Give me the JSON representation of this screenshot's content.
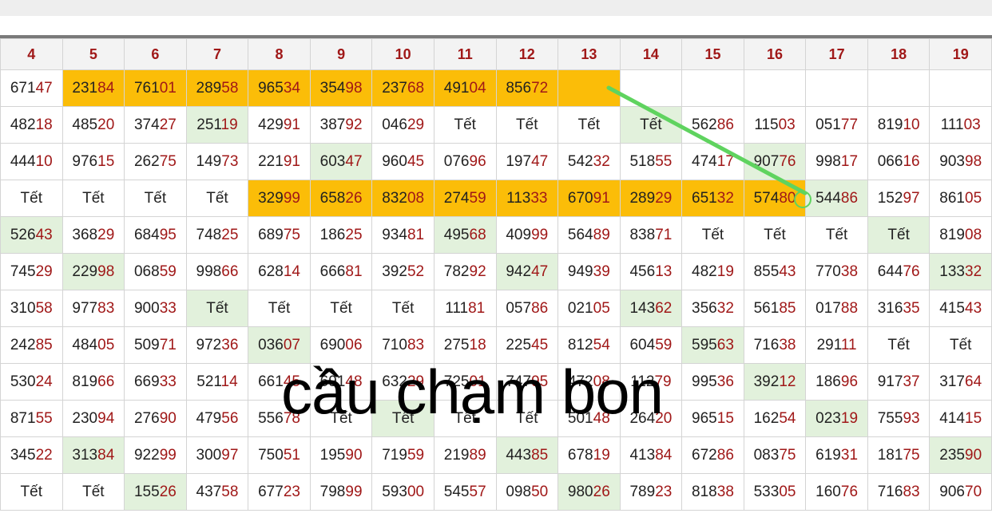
{
  "columns": [
    "4",
    "5",
    "6",
    "7",
    "8",
    "9",
    "10",
    "11",
    "12",
    "13",
    "14",
    "15",
    "16",
    "17",
    "18",
    "19"
  ],
  "rows": [
    [
      [
        "671",
        "47"
      ],
      [
        "231",
        "84"
      ],
      [
        "761",
        "01"
      ],
      [
        "289",
        "58"
      ],
      [
        "965",
        "34"
      ],
      [
        "354",
        "98"
      ],
      [
        "237",
        "68"
      ],
      [
        "491",
        "04"
      ],
      [
        "856",
        "72"
      ],
      [
        "",
        ""
      ],
      [
        "",
        ""
      ],
      [
        "",
        ""
      ],
      [
        "",
        ""
      ],
      [
        "",
        ""
      ],
      [
        "",
        ""
      ],
      [
        "",
        ""
      ]
    ],
    [
      [
        "482",
        "18"
      ],
      [
        "485",
        "20"
      ],
      [
        "374",
        "27"
      ],
      [
        "251",
        "19"
      ],
      [
        "429",
        "91"
      ],
      [
        "387",
        "92"
      ],
      [
        "046",
        "29"
      ],
      [
        "Tết",
        ""
      ],
      [
        "Tết",
        ""
      ],
      [
        "Tết",
        ""
      ],
      [
        "Tết",
        ""
      ],
      [
        "562",
        "86"
      ],
      [
        "115",
        "03"
      ],
      [
        "051",
        "77"
      ],
      [
        "819",
        "10"
      ],
      [
        "111",
        "03"
      ]
    ],
    [
      [
        "444",
        "10"
      ],
      [
        "976",
        "15"
      ],
      [
        "262",
        "75"
      ],
      [
        "149",
        "73"
      ],
      [
        "221",
        "91"
      ],
      [
        "603",
        "47"
      ],
      [
        "960",
        "45"
      ],
      [
        "076",
        "96"
      ],
      [
        "197",
        "47"
      ],
      [
        "542",
        "32"
      ],
      [
        "518",
        "55"
      ],
      [
        "474",
        "17"
      ],
      [
        "907",
        "76"
      ],
      [
        "998",
        "17"
      ],
      [
        "066",
        "16"
      ],
      [
        "903",
        "98"
      ]
    ],
    [
      [
        "Tết",
        ""
      ],
      [
        "Tết",
        ""
      ],
      [
        "Tết",
        ""
      ],
      [
        "Tết",
        ""
      ],
      [
        "329",
        "99"
      ],
      [
        "658",
        "26"
      ],
      [
        "832",
        "08"
      ],
      [
        "274",
        "59"
      ],
      [
        "113",
        "33"
      ],
      [
        "670",
        "91"
      ],
      [
        "289",
        "29"
      ],
      [
        "651",
        "32"
      ],
      [
        "574",
        "80"
      ],
      [
        "544",
        "86"
      ],
      [
        "152",
        "97"
      ],
      [
        "861",
        "05"
      ]
    ],
    [
      [
        "526",
        "43"
      ],
      [
        "368",
        "29"
      ],
      [
        "684",
        "95"
      ],
      [
        "748",
        "25"
      ],
      [
        "689",
        "75"
      ],
      [
        "186",
        "25"
      ],
      [
        "934",
        "81"
      ],
      [
        "495",
        "68"
      ],
      [
        "409",
        "99"
      ],
      [
        "564",
        "89"
      ],
      [
        "838",
        "71"
      ],
      [
        "Tết",
        ""
      ],
      [
        "Tết",
        ""
      ],
      [
        "Tết",
        ""
      ],
      [
        "Tết",
        ""
      ],
      [
        "819",
        "08"
      ]
    ],
    [
      [
        "745",
        "29"
      ],
      [
        "229",
        "98"
      ],
      [
        "068",
        "59"
      ],
      [
        "998",
        "66"
      ],
      [
        "628",
        "14"
      ],
      [
        "666",
        "81"
      ],
      [
        "392",
        "52"
      ],
      [
        "782",
        "92"
      ],
      [
        "942",
        "47"
      ],
      [
        "949",
        "39"
      ],
      [
        "456",
        "13"
      ],
      [
        "482",
        "19"
      ],
      [
        "855",
        "43"
      ],
      [
        "770",
        "38"
      ],
      [
        "644",
        "76"
      ],
      [
        "133",
        "32"
      ]
    ],
    [
      [
        "310",
        "58"
      ],
      [
        "977",
        "83"
      ],
      [
        "900",
        "33"
      ],
      [
        "Tết",
        ""
      ],
      [
        "Tết",
        ""
      ],
      [
        "Tết",
        ""
      ],
      [
        "Tết",
        ""
      ],
      [
        "111",
        "81"
      ],
      [
        "057",
        "86"
      ],
      [
        "021",
        "05"
      ],
      [
        "143",
        "62"
      ],
      [
        "356",
        "32"
      ],
      [
        "561",
        "85"
      ],
      [
        "017",
        "88"
      ],
      [
        "316",
        "35"
      ],
      [
        "415",
        "43"
      ]
    ],
    [
      [
        "242",
        "85"
      ],
      [
        "484",
        "05"
      ],
      [
        "509",
        "71"
      ],
      [
        "972",
        "36"
      ],
      [
        "036",
        "07"
      ],
      [
        "690",
        "06"
      ],
      [
        "710",
        "83"
      ],
      [
        "275",
        "18"
      ],
      [
        "225",
        "45"
      ],
      [
        "812",
        "54"
      ],
      [
        "604",
        "59"
      ],
      [
        "595",
        "63"
      ],
      [
        "716",
        "38"
      ],
      [
        "291",
        "11"
      ],
      [
        "Tết",
        ""
      ],
      [
        "Tết",
        ""
      ]
    ],
    [
      [
        "530",
        "24"
      ],
      [
        "819",
        "66"
      ],
      [
        "669",
        "33"
      ],
      [
        "521",
        "14"
      ],
      [
        "661",
        "45"
      ],
      [
        "691",
        "48"
      ],
      [
        "632",
        "29"
      ],
      [
        "725",
        "01"
      ],
      [
        "747",
        "95"
      ],
      [
        "472",
        "08"
      ],
      [
        "112",
        "79"
      ],
      [
        "995",
        "36"
      ],
      [
        "392",
        "12"
      ],
      [
        "186",
        "96"
      ],
      [
        "917",
        "37"
      ],
      [
        "317",
        "64"
      ]
    ],
    [
      [
        "871",
        "55"
      ],
      [
        "230",
        "94"
      ],
      [
        "276",
        "90"
      ],
      [
        "479",
        "56"
      ],
      [
        "556",
        "78"
      ],
      [
        "Tết",
        ""
      ],
      [
        "Tết",
        ""
      ],
      [
        "Tết",
        ""
      ],
      [
        "Tết",
        ""
      ],
      [
        "501",
        "48"
      ],
      [
        "264",
        "20"
      ],
      [
        "965",
        "15"
      ],
      [
        "162",
        "54"
      ],
      [
        "023",
        "19"
      ],
      [
        "755",
        "93"
      ],
      [
        "414",
        "15"
      ]
    ],
    [
      [
        "345",
        "22"
      ],
      [
        "313",
        "84"
      ],
      [
        "922",
        "99"
      ],
      [
        "300",
        "97"
      ],
      [
        "750",
        "51"
      ],
      [
        "195",
        "90"
      ],
      [
        "719",
        "59"
      ],
      [
        "219",
        "89"
      ],
      [
        "443",
        "85"
      ],
      [
        "678",
        "19"
      ],
      [
        "413",
        "84"
      ],
      [
        "672",
        "86"
      ],
      [
        "083",
        "75"
      ],
      [
        "619",
        "31"
      ],
      [
        "181",
        "75"
      ],
      [
        "235",
        "90"
      ]
    ],
    [
      [
        "Tết",
        ""
      ],
      [
        "Tết",
        ""
      ],
      [
        "155",
        "26"
      ],
      [
        "437",
        "58"
      ],
      [
        "677",
        "23"
      ],
      [
        "798",
        "99"
      ],
      [
        "593",
        "00"
      ],
      [
        "545",
        "57"
      ],
      [
        "098",
        "50"
      ],
      [
        "980",
        "26"
      ],
      [
        "789",
        "23"
      ],
      [
        "818",
        "38"
      ],
      [
        "533",
        "05"
      ],
      [
        "160",
        "76"
      ],
      [
        "716",
        "83"
      ],
      [
        "906",
        "70"
      ]
    ]
  ],
  "highlights": {
    "orange": [
      "0-1",
      "0-2",
      "0-3",
      "0-4",
      "0-5",
      "0-6",
      "0-7",
      "0-8",
      "0-9",
      "3-4",
      "3-5",
      "3-6",
      "3-7",
      "3-8",
      "3-9",
      "3-10",
      "3-11",
      "3-12"
    ],
    "green": [
      "1-3",
      "1-10",
      "2-5",
      "2-12",
      "3-13",
      "4-0",
      "4-7",
      "4-14",
      "5-1",
      "5-8",
      "5-15",
      "6-3",
      "6-10",
      "7-4",
      "7-11",
      "8-12",
      "9-6",
      "9-13",
      "10-1",
      "10-8",
      "10-15",
      "11-2",
      "11-9"
    ]
  },
  "colors": {
    "orange": "#fbbd08",
    "green_cell": "#e2f1dc",
    "arrow": "#5fd35f",
    "tail_digits": "#a01818"
  },
  "caption": "cầu chạm bon"
}
